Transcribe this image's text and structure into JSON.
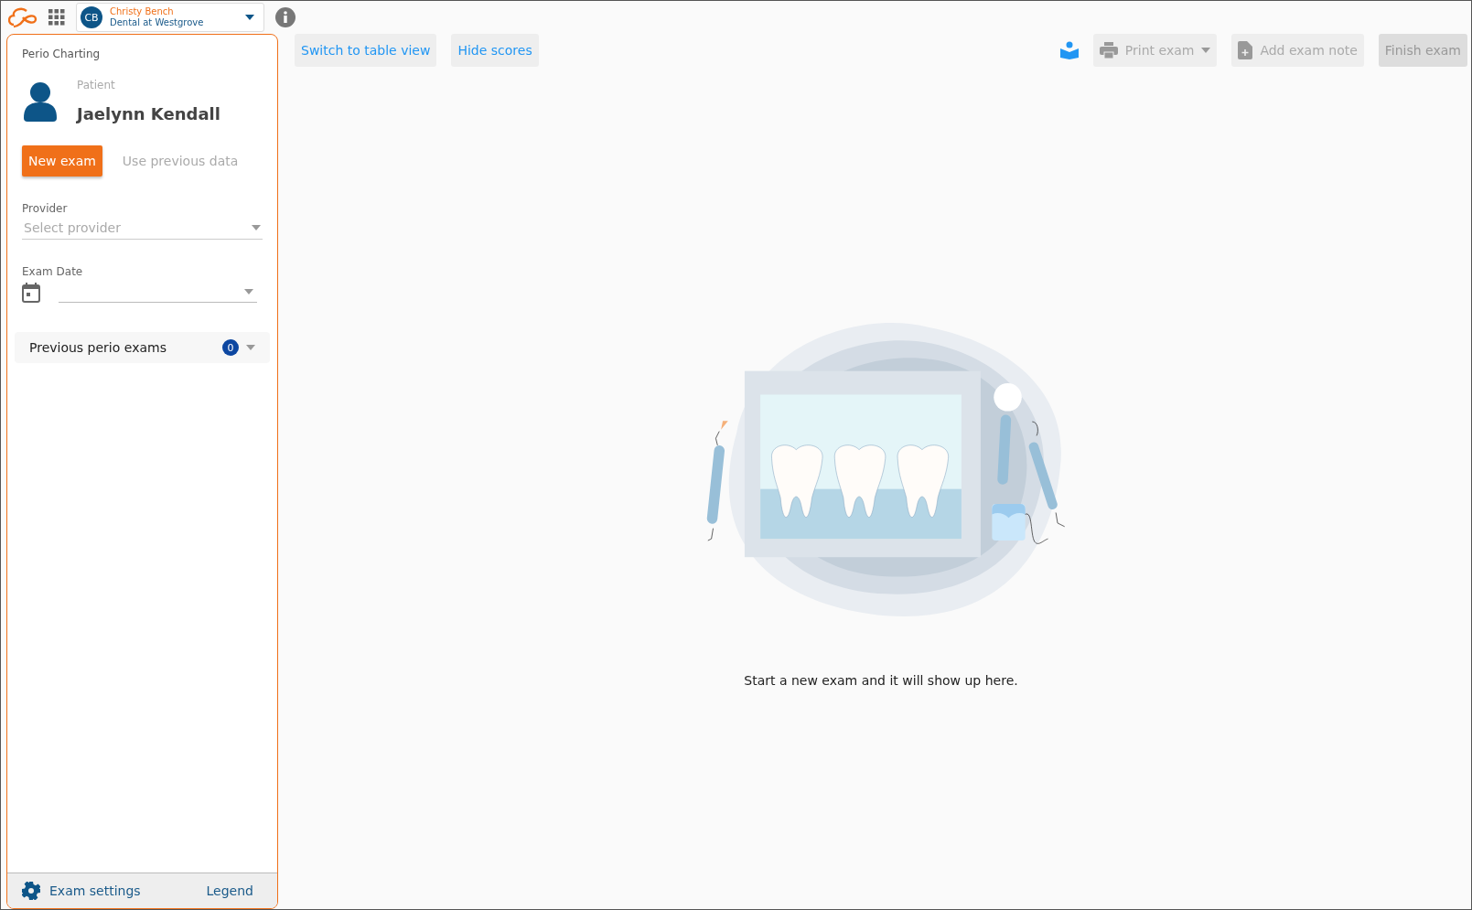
{
  "topbar": {
    "user": {
      "initials": "CB",
      "name": "Christy Bench",
      "practice": "Dental at Westgrove"
    }
  },
  "sidebar": {
    "title": "Perio Charting",
    "patient_label": "Patient",
    "patient_name": "Jaelynn Kendall",
    "actions": [
      {
        "label": "New exam",
        "kind": "primary"
      },
      {
        "label": "Use previous data",
        "kind": "text"
      }
    ],
    "provider": {
      "label": "Provider",
      "placeholder": "Select provider"
    },
    "exam_date": {
      "label": "Exam Date"
    },
    "previous_exams": {
      "label": "Previous perio exams",
      "count": "0",
      "expanded": false
    },
    "footer": {
      "settings": "Exam settings",
      "legend": "Legend"
    }
  },
  "toolbar": {
    "left": [
      {
        "label": "Switch to table view",
        "disabled": false
      },
      {
        "label": "Hide scores",
        "disabled": false
      }
    ],
    "right": [
      {
        "label": "Print exam",
        "kind": "print",
        "disabled": true
      },
      {
        "label": "Add exam note",
        "kind": "note",
        "disabled": true
      },
      {
        "label": "Finish exam",
        "kind": "plain",
        "disabled": true
      }
    ]
  },
  "empty_state": {
    "kind": "picture",
    "message": "Start a new exam and it will show up here."
  }
}
